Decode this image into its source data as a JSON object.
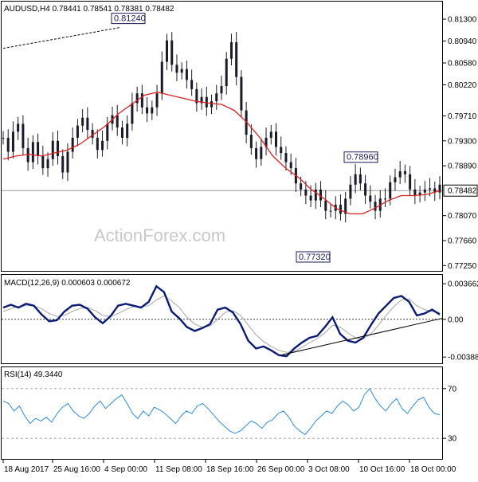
{
  "chart_data": {
    "type": "candlestick",
    "symbol_header": "AUDUSD,H4  0.78441 0.78541 0.78381 0.78482",
    "watermark": "ActionForex.com",
    "price_panel": {
      "ylim": [
        0.77215,
        0.8151
      ],
      "y_ticks": [
        "0.81300",
        "0.80940",
        "0.80580",
        "0.80220",
        "0.79710",
        "0.79300",
        "0.78890",
        "0.78482",
        "0.78070",
        "0.77660",
        "0.77250"
      ],
      "y_tick_values": [
        0.813,
        0.8094,
        0.8058,
        0.8022,
        0.7971,
        0.793,
        0.7889,
        0.78482,
        0.7807,
        0.7766,
        0.7725
      ],
      "current_price": "0.78482",
      "annotations": [
        {
          "text": "0.81240",
          "value": 0.8124
        },
        {
          "text": "0.78960",
          "value": 0.7896
        },
        {
          "text": "0.77320",
          "value": 0.7732
        }
      ],
      "close": [
        0.7935,
        0.7912,
        0.7945,
        0.7958,
        0.7918,
        0.7895,
        0.7928,
        0.7905,
        0.7885,
        0.79,
        0.793,
        0.7905,
        0.7878,
        0.7912,
        0.7935,
        0.7955,
        0.7968,
        0.7948,
        0.7935,
        0.7915,
        0.793,
        0.7958,
        0.7972,
        0.7952,
        0.7935,
        0.7958,
        0.7992,
        0.8008,
        0.7985,
        0.7975,
        0.7985,
        0.8008,
        0.806,
        0.8095,
        0.8055,
        0.8042,
        0.8048,
        0.803,
        0.8015,
        0.7992,
        0.8002,
        0.7985,
        0.7995,
        0.8008,
        0.802,
        0.8065,
        0.8092,
        0.8035,
        0.798,
        0.794,
        0.7918,
        0.79,
        0.792,
        0.7935,
        0.7945,
        0.792,
        0.791,
        0.7895,
        0.7885,
        0.786,
        0.785,
        0.784,
        0.7832,
        0.785,
        0.7832,
        0.7815,
        0.7815,
        0.7825,
        0.781,
        0.7835,
        0.7858,
        0.7875,
        0.786,
        0.784,
        0.783,
        0.7815,
        0.7835,
        0.7835,
        0.7862,
        0.787,
        0.788,
        0.7875,
        0.785,
        0.784,
        0.7845,
        0.785,
        0.7852,
        0.7845,
        0.7858
      ],
      "ma_points": [
        0.79,
        0.7905,
        0.7908,
        0.7905,
        0.791,
        0.7915,
        0.7925,
        0.794,
        0.7955,
        0.7975,
        0.799,
        0.8005,
        0.801,
        0.8005,
        0.8,
        0.7995,
        0.7992,
        0.799,
        0.798,
        0.796,
        0.7935,
        0.7905,
        0.7885,
        0.787,
        0.785,
        0.7835,
        0.7818,
        0.781,
        0.781,
        0.782,
        0.7832,
        0.784,
        0.784,
        0.7842,
        0.7848
      ]
    },
    "macd_panel": {
      "label": "MACD(12,26,9) 0.000603 0.000672",
      "ylim": [
        -0.0042,
        0.004
      ],
      "y_ticks": [
        "0.003662",
        "0.00",
        "-0.003887"
      ],
      "y_tick_values": [
        0.003662,
        0.0,
        -0.003887
      ],
      "macd": [
        0.0012,
        0.0015,
        0.0012,
        0.0016,
        0.0014,
        0.0005,
        -0.0002,
        -0.0001,
        0.0008,
        0.0014,
        0.0015,
        0.0011,
        0.0002,
        -0.0004,
        0.0003,
        0.0014,
        0.0016,
        0.0014,
        0.0012,
        0.0018,
        0.0034,
        0.0028,
        0.0008,
        0.0001,
        -0.0008,
        -0.0012,
        -0.0009,
        -0.0005,
        0.001,
        0.0012,
        0.0007,
        -0.0005,
        -0.0022,
        -0.003,
        -0.0028,
        -0.0032,
        -0.0037,
        -0.0038,
        -0.003,
        -0.0024,
        -0.0019,
        -0.0017,
        -0.0008,
        0.0002,
        -0.0015,
        -0.0022,
        -0.0024,
        -0.0019,
        -0.0006,
        0.0006,
        0.0014,
        0.0022,
        0.0024,
        0.0018,
        0.0004,
        0.0006,
        0.001,
        0.0005
      ],
      "signal": [
        0.0008,
        0.0011,
        0.0013,
        0.0014,
        0.0014,
        0.0011,
        0.0006,
        0.0003,
        0.0004,
        0.0008,
        0.0011,
        0.0012,
        0.0009,
        0.0004,
        0.0003,
        0.0006,
        0.001,
        0.0013,
        0.0013,
        0.0014,
        0.002,
        0.0024,
        0.0019,
        0.0012,
        0.0002,
        -0.0005,
        -0.0008,
        -0.0007,
        0.0,
        0.0007,
        0.0009,
        0.0004,
        -0.0006,
        -0.0016,
        -0.0023,
        -0.0028,
        -0.0032,
        -0.0034,
        -0.0033,
        -0.0029,
        -0.0024,
        -0.002,
        -0.0014,
        -0.0006,
        -0.0008,
        -0.0014,
        -0.0019,
        -0.002,
        -0.0015,
        -0.0006,
        0.0004,
        0.0013,
        0.002,
        0.0021,
        0.0014,
        0.001,
        0.0008,
        0.0007
      ]
    },
    "rsi_panel": {
      "label": "RSI(14) 49.3440",
      "ylim": [
        16,
        84
      ],
      "y_ticks": [
        "70",
        "30"
      ],
      "y_tick_values": [
        70,
        30
      ],
      "values": [
        60,
        58,
        52,
        56,
        48,
        42,
        46,
        44,
        47,
        43,
        50,
        55,
        58,
        52,
        48,
        46,
        50,
        56,
        60,
        54,
        58,
        62,
        65,
        58,
        50,
        46,
        52,
        48,
        55,
        53,
        50,
        46,
        42,
        48,
        52,
        50,
        56,
        58,
        54,
        49,
        44,
        40,
        36,
        34,
        36,
        40,
        44,
        42,
        38,
        43,
        45,
        50,
        52,
        47,
        40,
        36,
        33,
        38,
        44,
        48,
        52,
        50,
        56,
        60,
        57,
        52,
        55,
        65,
        70,
        62,
        56,
        52,
        58,
        62,
        54,
        50,
        56,
        61,
        63,
        55,
        50,
        49
      ]
    },
    "x_ticks": [
      "18 Aug 2017",
      "25 Aug 16:00",
      "4 Sep 00:00",
      "11 Sep 08:00",
      "18 Sep 16:00",
      "26 Sep 00:00",
      "3 Oct 08:00",
      "10 Oct 16:00",
      "18 Oct 00:00"
    ]
  }
}
